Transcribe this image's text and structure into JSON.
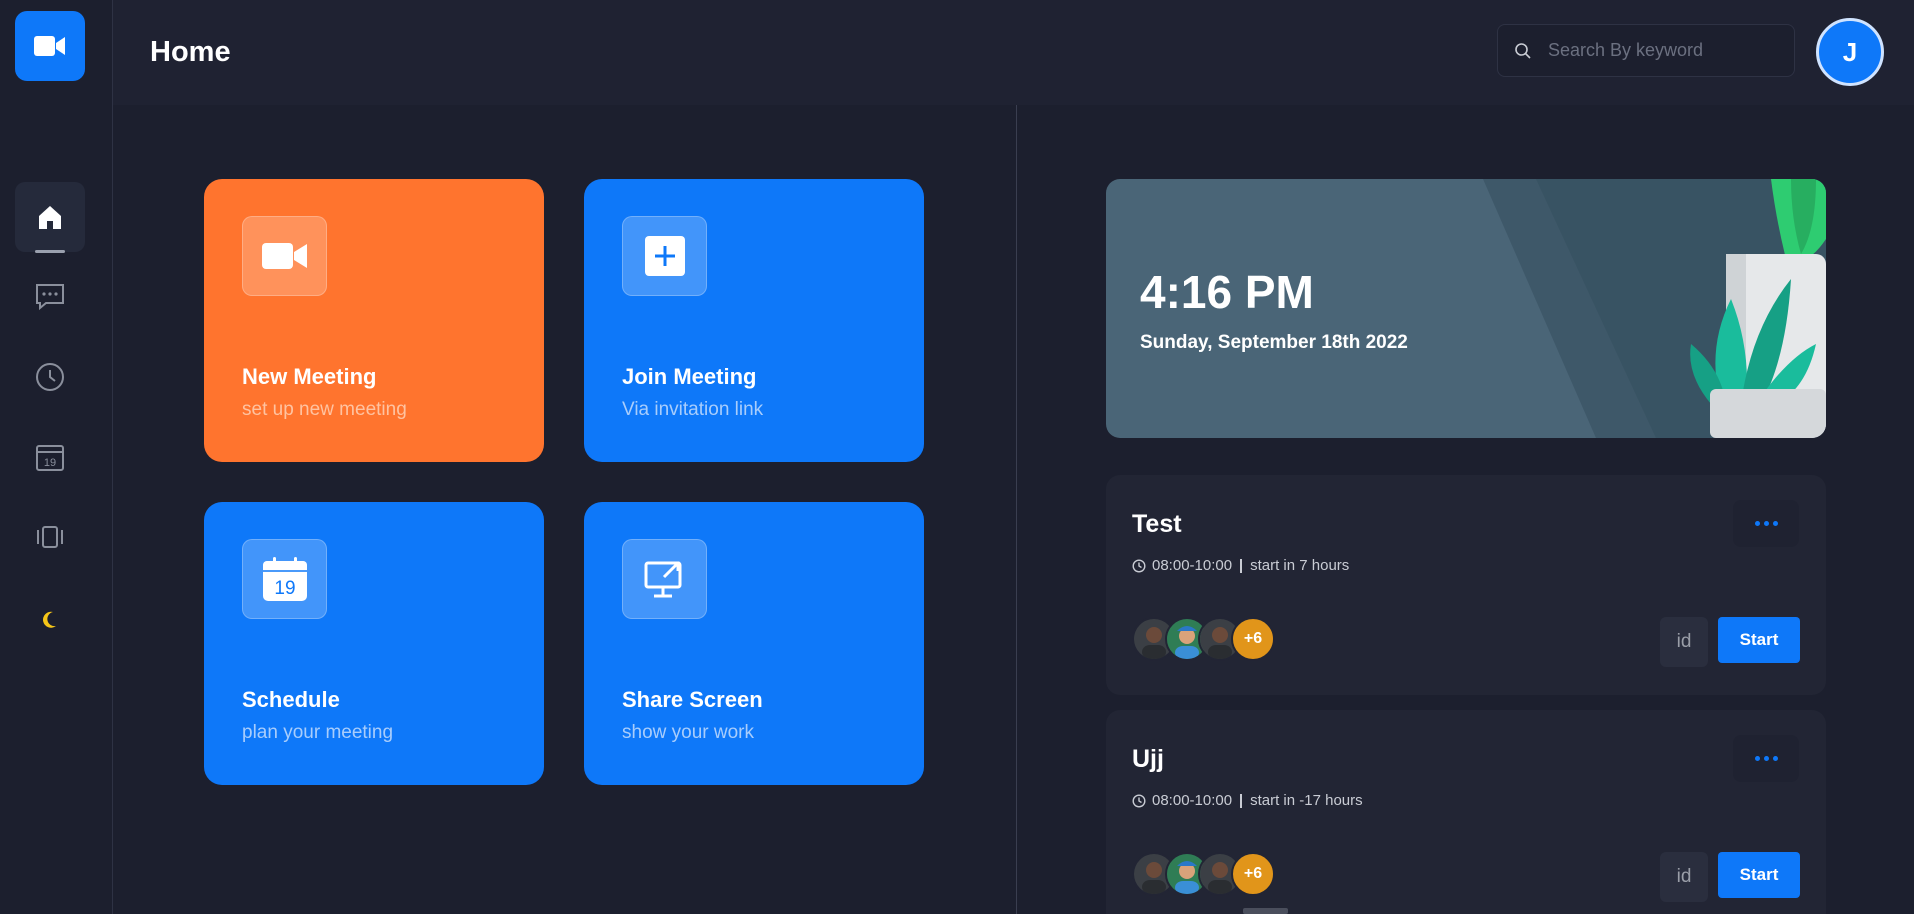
{
  "header": {
    "title": "Home",
    "search_placeholder": "Search By keyword",
    "avatar_initial": "J"
  },
  "sidebar": {
    "items": [
      {
        "name": "home",
        "active": true
      },
      {
        "name": "chat",
        "active": false
      },
      {
        "name": "history",
        "active": false
      },
      {
        "name": "calendar",
        "active": false
      },
      {
        "name": "recordings",
        "active": false
      },
      {
        "name": "theme",
        "active": false
      }
    ]
  },
  "actions": [
    {
      "title": "New Meeting",
      "subtitle": "set up new meeting",
      "color": "#ff742e",
      "icon": "video-icon"
    },
    {
      "title": "Join Meeting",
      "subtitle": "Via invitation link",
      "color": "#0e78f9",
      "icon": "plus-icon"
    },
    {
      "title": "Schedule",
      "subtitle": "plan your meeting",
      "color": "#0e78f9",
      "icon": "calendar-icon"
    },
    {
      "title": "Share Screen",
      "subtitle": "show your work",
      "color": "#0e78f9",
      "icon": "share-screen-icon"
    }
  ],
  "calendar_icon_day": "19",
  "clock": {
    "time": "4:16 PM",
    "date": "Sunday, September 18th 2022"
  },
  "meetings": [
    {
      "title": "Test",
      "time_range": "08:00-10:00",
      "starts": "start in 7 hours",
      "extra_participants": "+6",
      "id_label": "id",
      "start_label": "Start"
    },
    {
      "title": "Ujj",
      "time_range": "08:00-10:00",
      "starts": "start in -17 hours",
      "extra_participants": "+6",
      "id_label": "id",
      "start_label": "Start"
    }
  ],
  "colors": {
    "accent": "#0e78f9",
    "orange": "#ff742e",
    "background": "#1c1f2e",
    "moon": "#f5c518"
  }
}
